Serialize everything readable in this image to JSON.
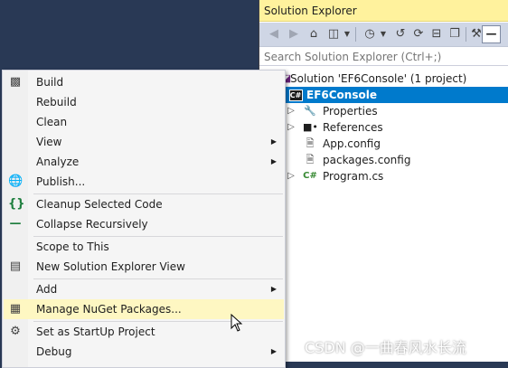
{
  "solution_explorer": {
    "title": "Solution Explorer",
    "search_placeholder": "Search Solution Explorer (Ctrl+;)",
    "toolbar": {
      "back_icon": "back-arrow-icon",
      "forward_icon": "forward-arrow-icon",
      "home_icon": "home-icon",
      "switch_views_icon": "switch-views-icon",
      "pending_changes_icon": "clock-history-icon",
      "sync_icon": "sync-icon",
      "refresh_icon": "refresh-icon",
      "collapse_all_icon": "collapse-all-icon",
      "copy_icon": "copy-icon",
      "properties_icon": "wrench-icon",
      "pin_icon": "pin-icon"
    },
    "tree": [
      {
        "label": "Solution 'EF6Console' (1 project)",
        "icon": "solution-icon",
        "selected": false
      },
      {
        "label": "EF6Console",
        "icon": "csharp-project-icon",
        "selected": true
      },
      {
        "label": "Properties",
        "icon": "wrench-icon",
        "selected": false
      },
      {
        "label": "References",
        "icon": "references-icon",
        "selected": false
      },
      {
        "label": "App.config",
        "icon": "config-file-icon",
        "selected": false
      },
      {
        "label": "packages.config",
        "icon": "config-file-icon",
        "selected": false
      },
      {
        "label": "Program.cs",
        "icon": "csharp-file-icon",
        "selected": false
      }
    ]
  },
  "context_menu": {
    "items": [
      {
        "label": "Build",
        "icon": "build-icon"
      },
      {
        "label": "Rebuild",
        "icon": ""
      },
      {
        "label": "Clean",
        "icon": ""
      },
      {
        "label": "View",
        "icon": "",
        "submenu": true
      },
      {
        "label": "Analyze",
        "icon": "",
        "submenu": true
      },
      {
        "label": "Publish...",
        "icon": "globe-icon"
      },
      {
        "label": "Cleanup Selected Code",
        "icon": "braces-icon"
      },
      {
        "label": "Collapse Recursively",
        "icon": "minus-icon"
      },
      {
        "label": "Scope to This",
        "icon": ""
      },
      {
        "label": "New Solution Explorer View",
        "icon": "new-view-icon"
      },
      {
        "label": "Add",
        "icon": "",
        "submenu": true
      },
      {
        "label": "Manage NuGet Packages...",
        "icon": "nuget-icon",
        "hovered": true
      },
      {
        "label": "Set as StartUp Project",
        "icon": "gear-icon"
      },
      {
        "label": "Debug",
        "icon": "",
        "submenu": true
      }
    ]
  },
  "watermark": "CSDN @一曲春风水长流",
  "colors": {
    "background": "#293955",
    "title_bar": "#fff29d",
    "toolbar": "#cfd6e5",
    "selection": "#007acc",
    "menu_hover": "#fef7c2"
  }
}
